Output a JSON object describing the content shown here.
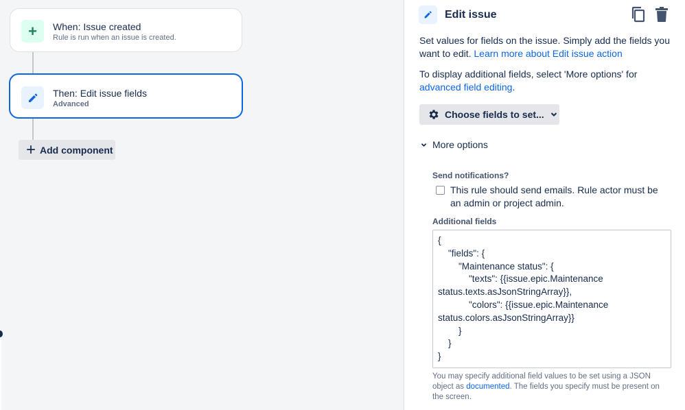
{
  "canvas": {
    "trigger": {
      "title": "When: Issue created",
      "subtitle": "Rule is run when an issue is created.",
      "icon": "plus-icon"
    },
    "action": {
      "title": "Then: Edit issue fields",
      "subtitle": "Advanced",
      "icon": "pencil-icon"
    },
    "add_component_label": "Add component"
  },
  "panel": {
    "title": "Edit issue",
    "description_text": "Set values for fields on the issue. Simply add the fields you want to edit.",
    "description_link": "Learn more about Edit issue action",
    "display_text": "To display additional fields, select 'More options' for",
    "display_link": "advanced field editing",
    "display_end": ".",
    "choose_fields_label": "Choose fields to set...",
    "more_options_label": "More options",
    "send_notifications_label": "Send notifications?",
    "send_notifications_text": "This rule should send emails. Rule actor must be an admin or project admin.",
    "send_notifications_checked": false,
    "additional_fields_label": "Additional fields",
    "additional_fields_value": "{\n    \"fields\": {\n        \"Maintenance status\": {\n            \"texts\": {{issue.epic.Maintenance status.texts.asJsonStringArray}},\n            \"colors\": {{issue.epic.Maintenance status.colors.asJsonStringArray}}\n        }\n    }\n}",
    "help_text_before": "You may specify additional field values to be set using a JSON object as",
    "help_link": "documented",
    "help_text_after": ". The fields you specify must be present on the screen."
  },
  "colors": {
    "accent": "#0c66e4",
    "trigger_icon_bg": "#dcfff1",
    "trigger_icon_fg": "#1f845a"
  }
}
